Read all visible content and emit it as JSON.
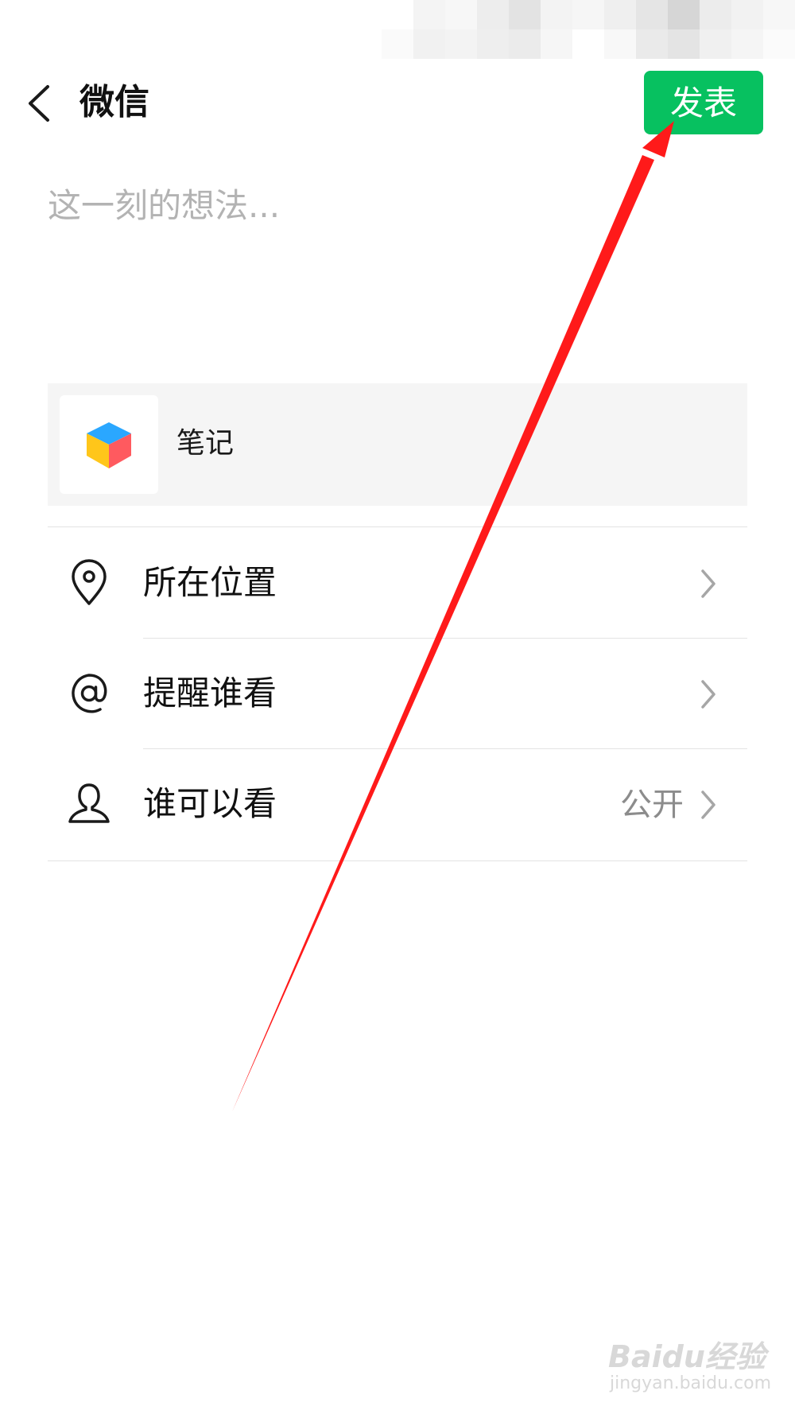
{
  "nav": {
    "title": "微信",
    "publish_label": "发表"
  },
  "compose": {
    "placeholder": "这一刻的想法..."
  },
  "share_card": {
    "title": "笔记",
    "icon": "cube-app-icon"
  },
  "options": [
    {
      "label": "所在位置",
      "icon": "location-pin-icon",
      "value": ""
    },
    {
      "label": "提醒谁看",
      "icon": "at-sign-icon",
      "value": ""
    },
    {
      "label": "谁可以看",
      "icon": "person-icon",
      "value": "公开"
    }
  ],
  "watermark": {
    "brand": "Baidu经验",
    "url": "jingyan.baidu.com"
  },
  "colors": {
    "accent": "#07c160",
    "annotation": "#ff1a1a"
  }
}
